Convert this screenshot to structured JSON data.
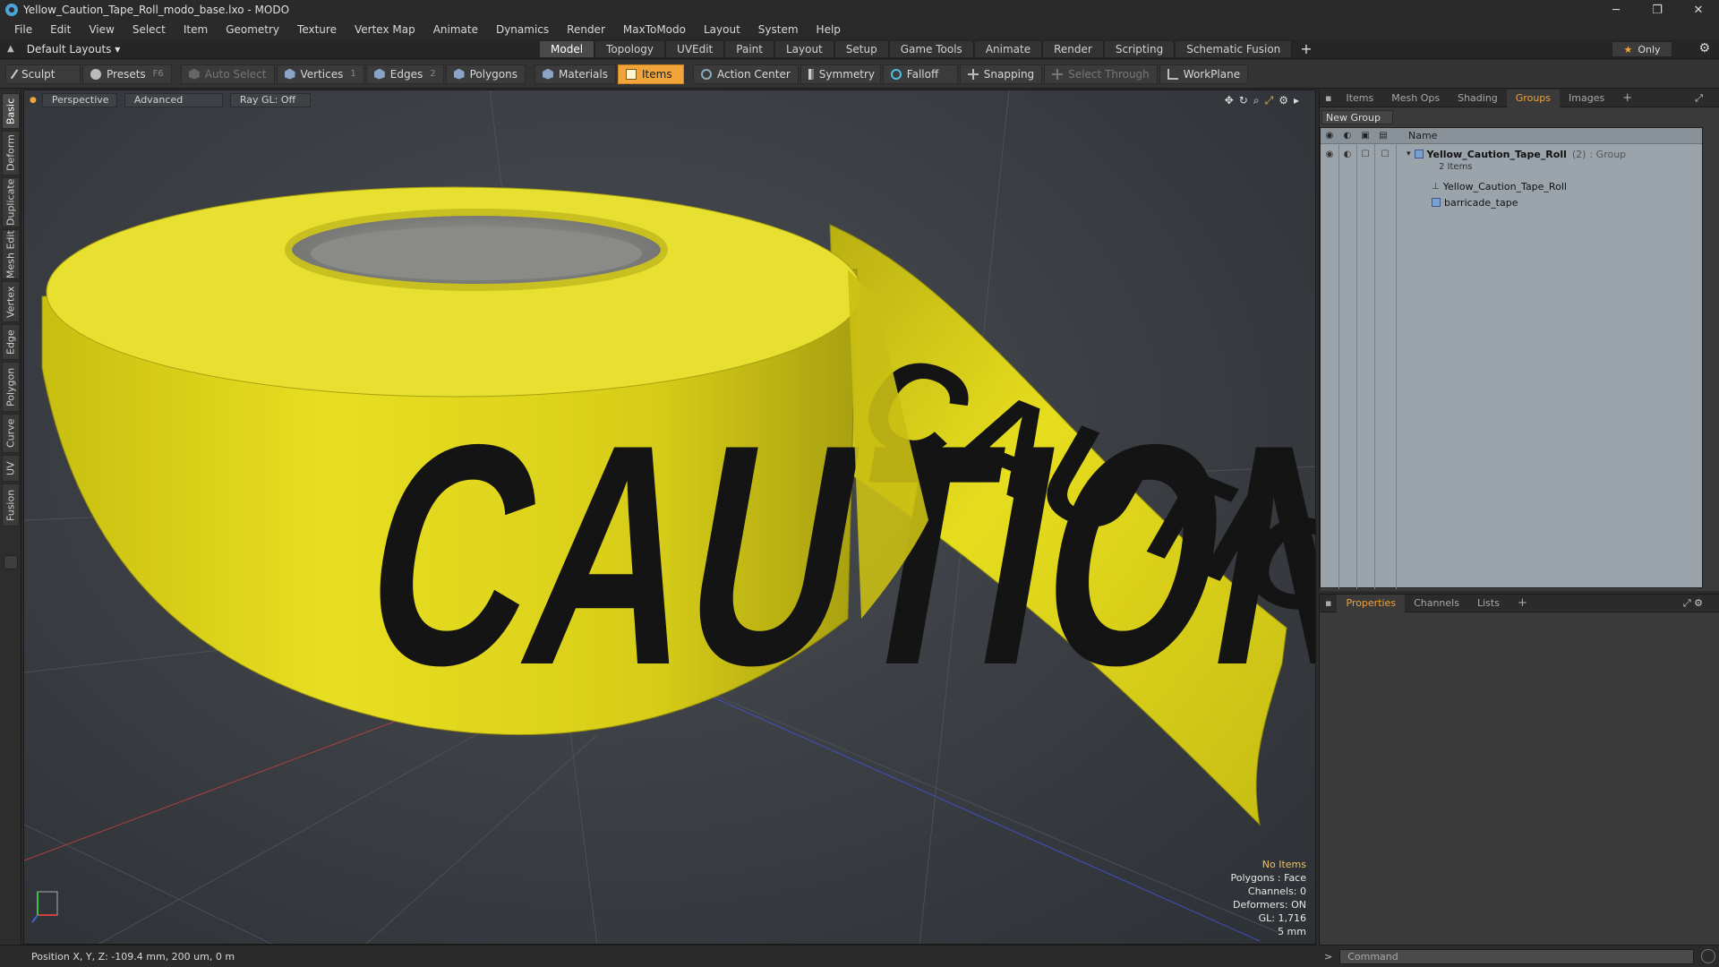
{
  "window": {
    "title": "Yellow_Caution_Tape_Roll_modo_base.lxo - MODO",
    "min": "─",
    "max": "❐",
    "close": "✕"
  },
  "menu": [
    "File",
    "Edit",
    "View",
    "Select",
    "Item",
    "Geometry",
    "Texture",
    "Vertex Map",
    "Animate",
    "Dynamics",
    "Render",
    "MaxToModo",
    "Layout",
    "System",
    "Help"
  ],
  "layoutbar": {
    "layouts_label": "Default Layouts ▾",
    "tabs": [
      "Model",
      "Topology",
      "UVEdit",
      "Paint",
      "Layout",
      "Setup",
      "Game Tools",
      "Animate",
      "Render",
      "Scripting",
      "Schematic Fusion"
    ],
    "active_tab": "Model",
    "only_label": "Only"
  },
  "toolbar": {
    "sculpt": "Sculpt",
    "presets": "Presets",
    "presets_key": "F6",
    "auto_select": "Auto Select",
    "vertices": "Vertices",
    "vertices_key": "1",
    "edges": "Edges",
    "edges_key": "2",
    "polygons": "Polygons",
    "materials": "Materials",
    "items": "Items",
    "action_center": "Action Center",
    "symmetry": "Symmetry",
    "falloff": "Falloff",
    "snapping": "Snapping",
    "select_through": "Select Through",
    "workplane": "WorkPlane"
  },
  "lefttabs": [
    "Basic",
    "Deform",
    "Duplicate",
    "Mesh Edit",
    "Vertex",
    "Edge",
    "Polygon",
    "Curve",
    "UV",
    "Fusion"
  ],
  "viewport": {
    "view": "Perspective",
    "advanced": "Advanced",
    "raygl": "Ray GL: Off",
    "info": {
      "selection": "No Items",
      "polygons": "Polygons : Face",
      "channels": "Channels: 0",
      "deformers": "Deformers: ON",
      "gl": "GL: 1,716",
      "scale": "5 mm"
    },
    "scene_text": "CAUTION",
    "colors": {
      "tape": "#e6dd1e",
      "ink": "#141414"
    }
  },
  "status": {
    "position": "Position X, Y, Z:  -109.4 mm, 200 um, 0 m"
  },
  "itempanel": {
    "tabs": [
      "Items",
      "Mesh Ops",
      "Shading",
      "Groups",
      "Images"
    ],
    "active_tab": "Groups",
    "new_group": "New Group",
    "name_header": "Name",
    "group": {
      "name": "Yellow_Caution_Tape_Roll",
      "count": "(2)",
      "type": ": Group",
      "sub": "2 Items"
    },
    "children": [
      "Yellow_Caution_Tape_Roll",
      "barricade_tape"
    ]
  },
  "propspanel": {
    "tabs": [
      "Properties",
      "Channels",
      "Lists"
    ],
    "active_tab": "Properties"
  },
  "command": {
    "placeholder": "Command"
  }
}
